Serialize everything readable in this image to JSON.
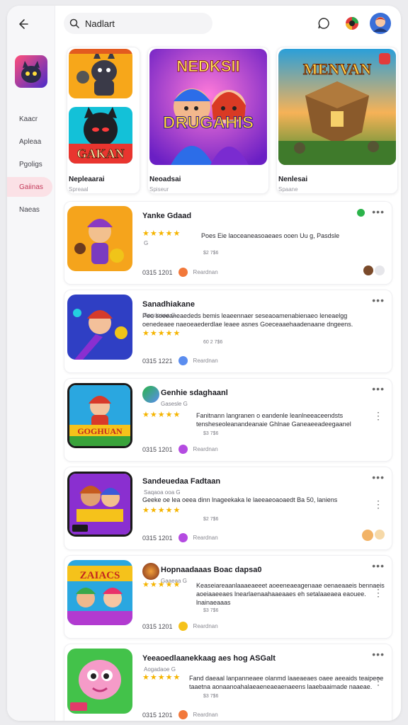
{
  "search": {
    "value": "Nadlart"
  },
  "sidebar": {
    "items": [
      {
        "label": "Kaacr"
      },
      {
        "label": "Apleaa"
      },
      {
        "label": "Pgoligs"
      },
      {
        "label": "Gaiinas"
      },
      {
        "label": "Naeas"
      }
    ]
  },
  "featured": [
    {
      "title": "Nepleaarai",
      "subtitle": "Spreaal",
      "art_text": "GAKAN"
    },
    {
      "title": "Neoadsai",
      "subtitle": "Spiseur",
      "art_text_top": "NEDKSII",
      "art_text_bottom": "DRUGAHIS"
    },
    {
      "title": "Nenlesai",
      "subtitle": "Spaane",
      "art_text": "MENVAN"
    }
  ],
  "games": [
    {
      "title": "Yanke Gdaad",
      "subtitle": "G",
      "stars": "★★★★★",
      "desc": "Poes Eie laoceaneasoaeaes ooen Uu g, Pasdsle",
      "price": "$2 7$6",
      "code": "0315 1201",
      "who": "Reardnan",
      "dot": "#f2783a"
    },
    {
      "title": "Sanadhiakane",
      "subtitle": "Soqdoaaa G",
      "stars": "★★★★★",
      "desc": "Peo soeeaneaededs bemis leaeennaer seseaoamenabienaeo leneaelgg oenedeaee naeoeaederdlae leaee asnes Goeceaaehaadenaane dngeens.",
      "price": "60 2 7$6",
      "code": "0315 1221",
      "who": "Reardnan",
      "dot": "#5b8def"
    },
    {
      "title": "Genhie sdaghaanl",
      "subtitle": "Gasesle G",
      "stars": "★★★★★",
      "desc": "Fanitnann langranen o eandenle leanlneeaceendsts tensheseoleanandeanaie Ghlnae Ganeaeeadeegaanel",
      "price": "$3 7$6",
      "code": "0315 1201",
      "who": "Reardnan",
      "dot": "#b44be1"
    },
    {
      "title": "Sandeuedaa Fadtaan",
      "subtitle": "Saqaoa ooa G",
      "stars": "★★★★★",
      "desc": "Geeke oe lea oeea dinn lnageekaka le laeeaeoaoaedt Ba 50, laniens",
      "price": "$2 7$6",
      "code": "0315 1201",
      "who": "Reardnan",
      "dot": "#b44be1"
    },
    {
      "title": "Hopnaadaaas Boac dapsa0",
      "subtitle": "Gaaeaa G",
      "stars": "★★★★★",
      "desc": "Keaseiareaanlaaaeaeeet aoeeneaeagenaae oenaeaaeis bennaeis aoeiaaeeaes lnearlaenaahaaeaaes eh setalaaeaea eaouee. lnainaeaaas",
      "price": "$3 7$6",
      "code": "0315 1201",
      "who": "Reardnan",
      "dot": "#f5c21b"
    },
    {
      "title": "Yeeaoedlaanekkaag aes hog ASGalt",
      "subtitle": "Aogadaoe G",
      "stars": "★★★★★",
      "desc": "Fand daeaal lanpanneaee olanmd laaeaeaes oaee aeeaids teaipeoe taaetna aonaanoahalaeaeneaeaenaeens laaebaaimade naaeae.",
      "price": "$3 7$6",
      "code": "0315 1201",
      "who": "Reardnan",
      "dot": "#f2783a"
    }
  ],
  "colors": {
    "accent": "#c43a5a",
    "active_bg": "#fbe1e6",
    "star": "#f5b400"
  }
}
